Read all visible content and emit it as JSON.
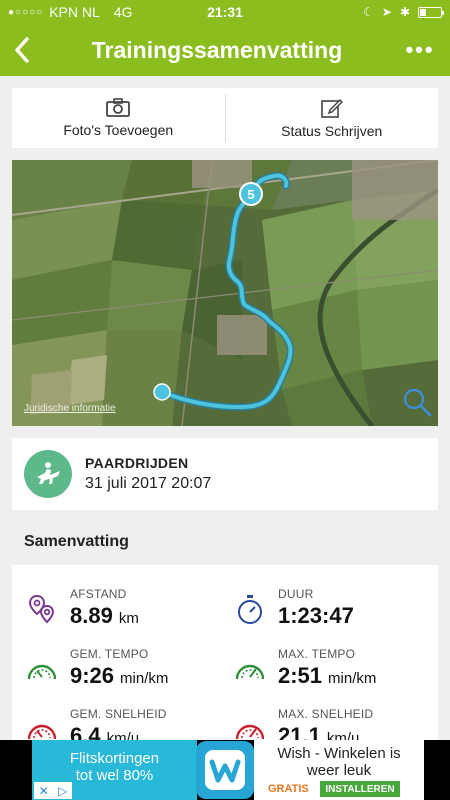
{
  "status": {
    "signal": "●○○○○",
    "carrier": "KPN NL",
    "network": "4G",
    "time": "21:31"
  },
  "nav": {
    "title": "Trainingssamenvatting",
    "more": "•••"
  },
  "actions": {
    "photo_label": "Foto's Toevoegen",
    "status_label": "Status Schrijven"
  },
  "map": {
    "legal": "Juridische informatie",
    "marker_number": "5"
  },
  "activity": {
    "type": "PAARDRIJDEN",
    "date": "31 juli 2017 20:07"
  },
  "summary": {
    "title": "Samenvatting",
    "distance": {
      "label": "AFSTAND",
      "value": "8.89",
      "unit": "km"
    },
    "duration": {
      "label": "DUUR",
      "value": "1:23:47"
    },
    "avg_pace": {
      "label": "GEM. TEMPO",
      "value": "9:26",
      "unit": "min/km"
    },
    "max_pace": {
      "label": "MAX. TEMPO",
      "value": "2:51",
      "unit": "min/km"
    },
    "avg_speed": {
      "label": "GEM. SNELHEID",
      "value": "6.4",
      "unit": "km/u"
    },
    "max_speed": {
      "label": "MAX. SNELHEID",
      "value": "21.1",
      "unit": "km/u"
    }
  },
  "ad": {
    "left_line1": "Flitskortingen",
    "left_line2": "tot wel 80%",
    "right_line1": "Wish - Winkelen is",
    "right_line2": "weer leuk",
    "gratis": "GRATIS",
    "install": "INSTALLEREN"
  },
  "colors": {
    "brand_green": "#8bbd1f",
    "route": "#4ec3de",
    "activity_circle": "#5db88a"
  }
}
